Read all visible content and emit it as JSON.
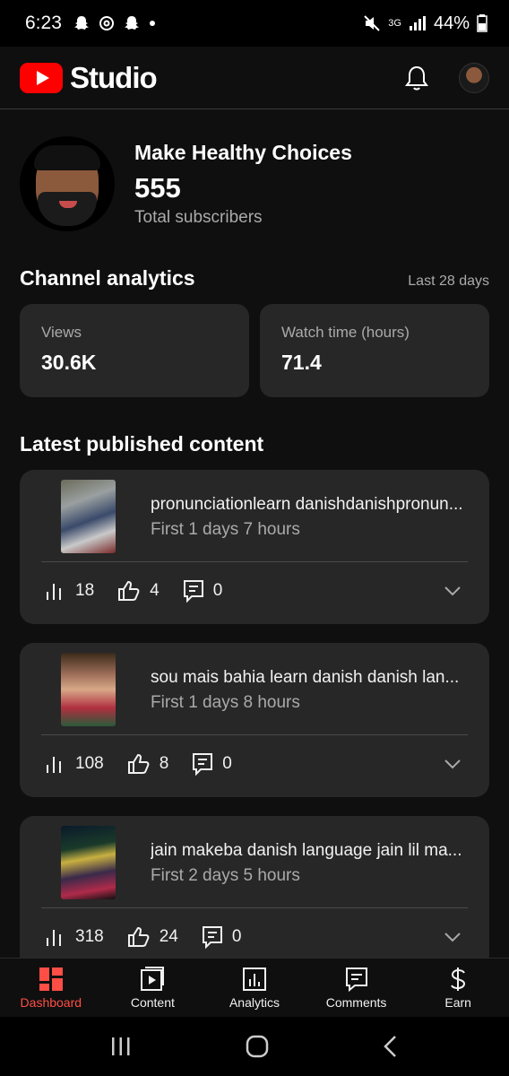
{
  "status_bar": {
    "time": "6:23",
    "network": "3G",
    "battery": "44%",
    "left_icons": [
      "snapchat-icon",
      "threads-icon",
      "snapchat-icon",
      "dot-icon"
    ],
    "right_icons": [
      "mute-icon",
      "network-icon",
      "signal-icon",
      "battery-icon"
    ]
  },
  "app_bar": {
    "brand": "Studio",
    "icons": [
      "youtube-logo-icon",
      "bell-icon",
      "profile-avatar"
    ]
  },
  "channel": {
    "name": "Make Healthy Choices",
    "subscribers": "555",
    "subscribers_label": "Total subscribers"
  },
  "analytics": {
    "title": "Channel analytics",
    "period": "Last 28 days",
    "cards": [
      {
        "label": "Views",
        "value": "30.6K"
      },
      {
        "label": "Watch time (hours)",
        "value": "71.4"
      }
    ]
  },
  "latest": {
    "title": "Latest published content",
    "items": [
      {
        "title": "pronunciationlearn danishdanishpronun...",
        "meta": "First 1 days 7 hours",
        "views": "18",
        "likes": "4",
        "comments": "0"
      },
      {
        "title": "sou mais bahia learn danish danish lan...",
        "meta": "First 1 days 8 hours",
        "views": "108",
        "likes": "8",
        "comments": "0"
      },
      {
        "title": "jain makeba danish language jain lil ma...",
        "meta": "First 2 days 5 hours",
        "views": "318",
        "likes": "24",
        "comments": "0"
      }
    ]
  },
  "bottom_nav": [
    {
      "label": "Dashboard",
      "icon": "dashboard-icon",
      "active": true
    },
    {
      "label": "Content",
      "icon": "content-icon",
      "active": false
    },
    {
      "label": "Analytics",
      "icon": "analytics-icon",
      "active": false
    },
    {
      "label": "Comments",
      "icon": "comments-icon",
      "active": false
    },
    {
      "label": "Earn",
      "icon": "earn-icon",
      "active": false
    }
  ],
  "colors": {
    "accent": "#ff0000",
    "active_nav": "#ff4e45",
    "card_bg": "#272727",
    "page_bg": "#0f0f0f"
  }
}
